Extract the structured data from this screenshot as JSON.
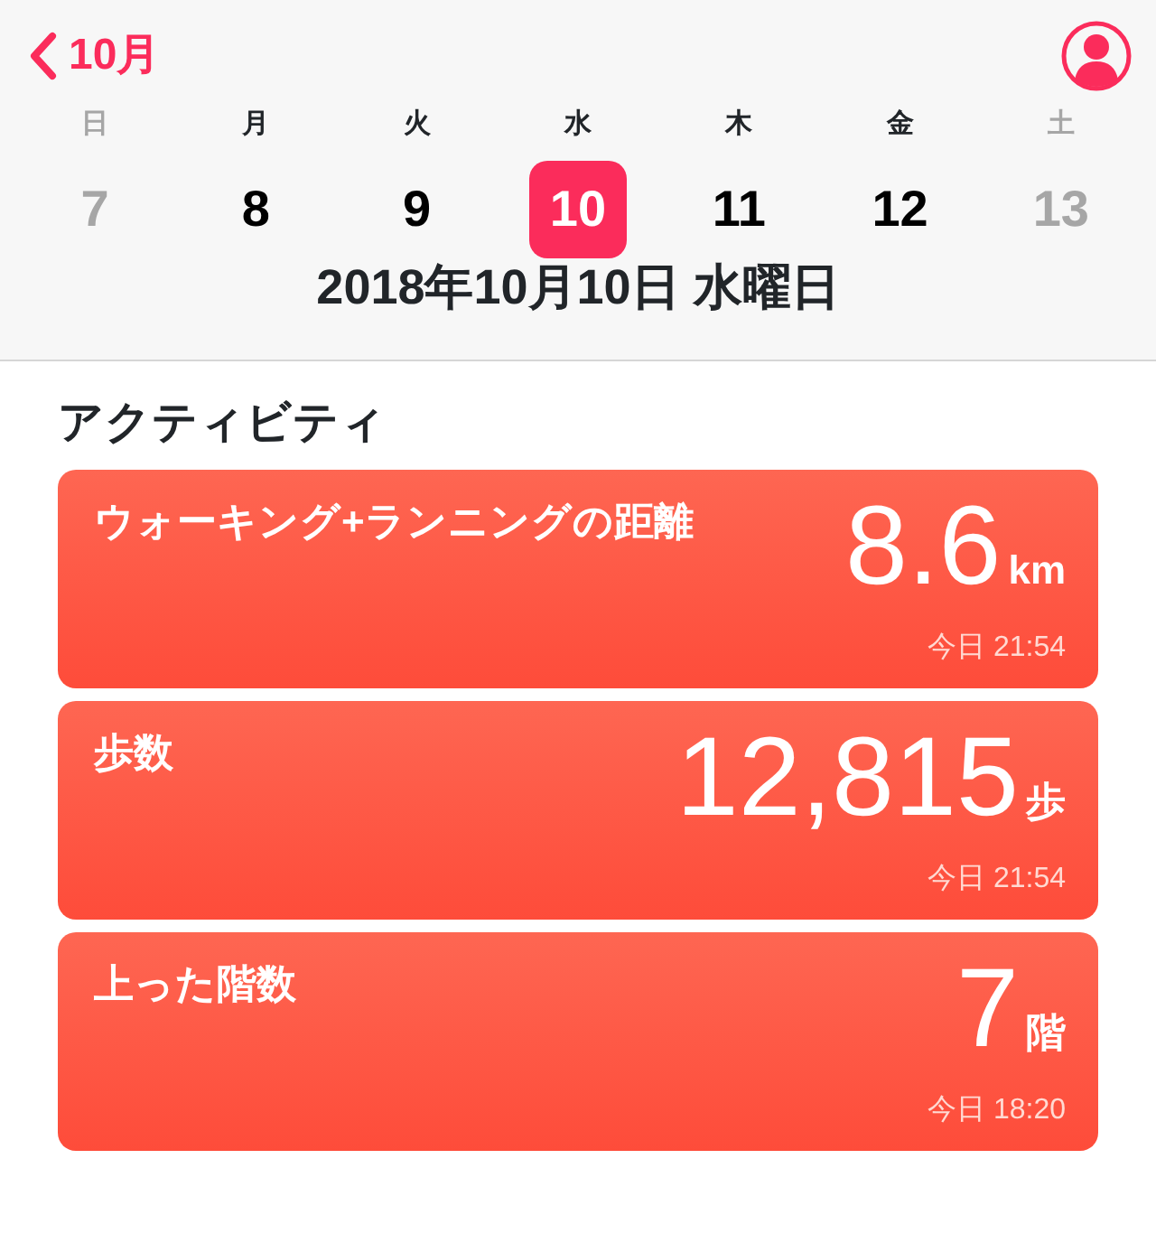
{
  "nav": {
    "back_label": "10月"
  },
  "week": [
    {
      "weekday": "日",
      "day": "7",
      "dimmed": true,
      "selected": false
    },
    {
      "weekday": "月",
      "day": "8",
      "dimmed": false,
      "selected": false
    },
    {
      "weekday": "火",
      "day": "9",
      "dimmed": false,
      "selected": false
    },
    {
      "weekday": "水",
      "day": "10",
      "dimmed": false,
      "selected": true
    },
    {
      "weekday": "木",
      "day": "11",
      "dimmed": false,
      "selected": false
    },
    {
      "weekday": "金",
      "day": "12",
      "dimmed": false,
      "selected": false
    },
    {
      "weekday": "土",
      "day": "13",
      "dimmed": true,
      "selected": false
    }
  ],
  "date_title": "2018年10月10日 水曜日",
  "section_title": "アクティビティ",
  "cards": [
    {
      "title": "ウォーキング+ランニングの距離",
      "value": "8.6",
      "unit": "km",
      "time": "今日 21:54"
    },
    {
      "title": "歩数",
      "value": "12,815",
      "unit": "歩",
      "time": "今日 21:54"
    },
    {
      "title": "上った階数",
      "value": "7",
      "unit": "階",
      "time": "今日 18:20"
    }
  ]
}
